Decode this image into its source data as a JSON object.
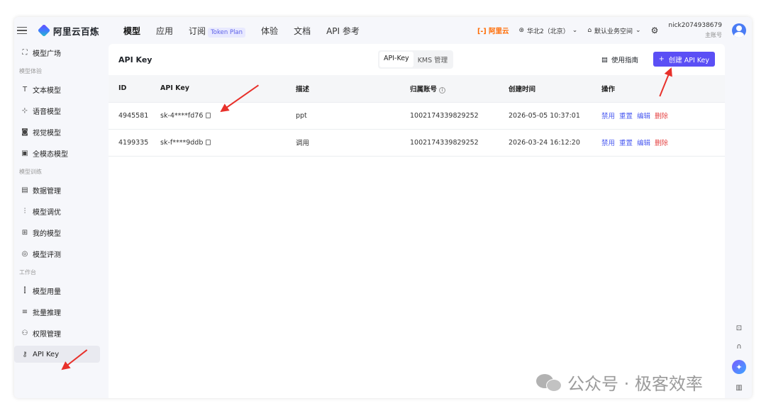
{
  "header": {
    "logo_text": "阿里云百炼",
    "nav": [
      {
        "label": "模型",
        "active": true
      },
      {
        "label": "应用"
      },
      {
        "label": "订阅",
        "badge": "Token Plan"
      },
      {
        "label": "体验"
      },
      {
        "label": "文档"
      },
      {
        "label": "API 参考"
      }
    ],
    "aliyun_logo": "[-] 阿里云",
    "region": "华北2（北京）",
    "workspace": "默认业务空间",
    "username": "nick2074938679",
    "account_type": "主账号"
  },
  "sidebar": {
    "items": [
      {
        "type": "item",
        "label": "模型广场",
        "icon": "model-square-icon",
        "glyph": "⛶"
      },
      {
        "type": "group",
        "label": "模型体验"
      },
      {
        "type": "item",
        "label": "文本模型",
        "icon": "text-icon",
        "glyph": "T"
      },
      {
        "type": "item",
        "label": "语音模型",
        "icon": "audio-icon",
        "glyph": "⊹"
      },
      {
        "type": "item",
        "label": "视觉模型",
        "icon": "camera-icon",
        "glyph": "◙"
      },
      {
        "type": "item",
        "label": "全模态模型",
        "icon": "omni-icon",
        "glyph": "▣"
      },
      {
        "type": "group",
        "label": "模型训练"
      },
      {
        "type": "item",
        "label": "数据管理",
        "icon": "data-icon",
        "glyph": "▤"
      },
      {
        "type": "item",
        "label": "模型调优",
        "icon": "tune-icon",
        "glyph": "⫶"
      },
      {
        "type": "item",
        "label": "我的模型",
        "icon": "my-models-icon",
        "glyph": "⊞"
      },
      {
        "type": "item",
        "label": "模型评测",
        "icon": "evaluate-icon",
        "glyph": "◎"
      },
      {
        "type": "group",
        "label": "工作台"
      },
      {
        "type": "item",
        "label": "模型用量",
        "icon": "usage-icon",
        "glyph": "⫿"
      },
      {
        "type": "item",
        "label": "批量推理",
        "icon": "batch-icon",
        "glyph": "≡"
      },
      {
        "type": "item",
        "label": "权限管理",
        "icon": "user-icon",
        "glyph": "⚇"
      },
      {
        "type": "item",
        "label": "API Key",
        "icon": "key-icon",
        "glyph": "⚷",
        "selected": true
      }
    ]
  },
  "main": {
    "title": "API Key",
    "tabs": [
      {
        "label": "API-Key",
        "active": true
      },
      {
        "label": "KMS 管理"
      }
    ],
    "guide_label": "使用指南",
    "create_label": "创建 API Key",
    "table": {
      "headers": [
        "ID",
        "API Key",
        "描述",
        "归属账号",
        "创建时间",
        "操作"
      ],
      "rows": [
        {
          "id": "4945581",
          "key": "sk-4****fd76",
          "desc": "ppt",
          "account": "1002174339829252",
          "created": "2026-05-05 10:37:01"
        },
        {
          "id": "4199335",
          "key": "sk-f****9ddb",
          "desc": "调用",
          "account": "1002174339829252",
          "created": "2026-03-24 16:12:20"
        }
      ],
      "actions": [
        "禁用",
        "重置",
        "编辑",
        "删除"
      ]
    }
  },
  "watermark": "公众号 · 极客效率"
}
